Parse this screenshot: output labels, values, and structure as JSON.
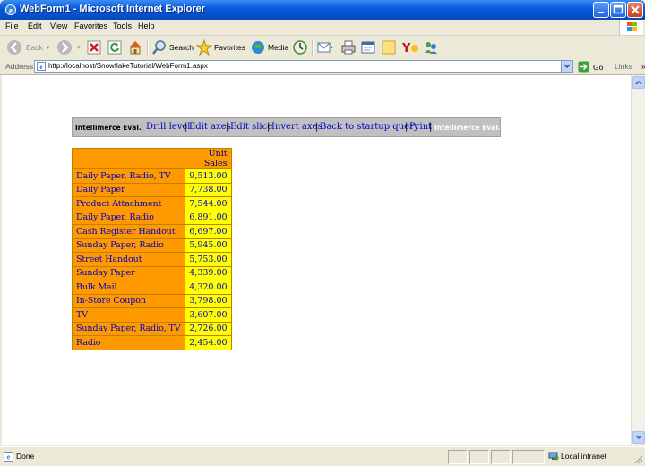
{
  "window": {
    "title": "WebForm1 - Microsoft Internet Explorer"
  },
  "menu": [
    "File",
    "Edit",
    "View",
    "Favorites",
    "Tools",
    "Help"
  ],
  "toolbar": {
    "back": "Back",
    "search": "Search",
    "favorites": "Favorites",
    "media": "Media"
  },
  "address": {
    "label": "Address",
    "url": "http://localhost/SnowflakeTutorial/WebForm1.aspx",
    "go": "Go",
    "links": "Links"
  },
  "status": {
    "text": "Done",
    "zone": "Local intranet"
  },
  "page": {
    "brand": "Intellimerce Eval.",
    "nav": [
      "Drill level",
      "Edit axes",
      "Edit slice",
      "Invert axes",
      "Back to startup query",
      "Print"
    ],
    "brand_right": "Intellimerce Eval.",
    "table": {
      "header": "Unit Sales",
      "rows": [
        {
          "label": "Daily Paper, Radio, TV",
          "value": "9,513.00"
        },
        {
          "label": "Daily Paper",
          "value": "7,738.00"
        },
        {
          "label": "Product Attachment",
          "value": "7,544.00"
        },
        {
          "label": "Daily Paper, Radio",
          "value": "6,891.00"
        },
        {
          "label": "Cash Register Handout",
          "value": "6,697.00"
        },
        {
          "label": "Sunday Paper, Radio",
          "value": "5,945.00"
        },
        {
          "label": "Street Handout",
          "value": "5,753.00"
        },
        {
          "label": "Sunday Paper",
          "value": "4,339.00"
        },
        {
          "label": "Bulk Mail",
          "value": "4,320.00"
        },
        {
          "label": "In-Store Coupon",
          "value": "3,798.00"
        },
        {
          "label": "TV",
          "value": "3,607.00"
        },
        {
          "label": "Sunday Paper, Radio, TV",
          "value": "2,726.00"
        },
        {
          "label": "Radio",
          "value": "2,454.00"
        }
      ]
    }
  }
}
